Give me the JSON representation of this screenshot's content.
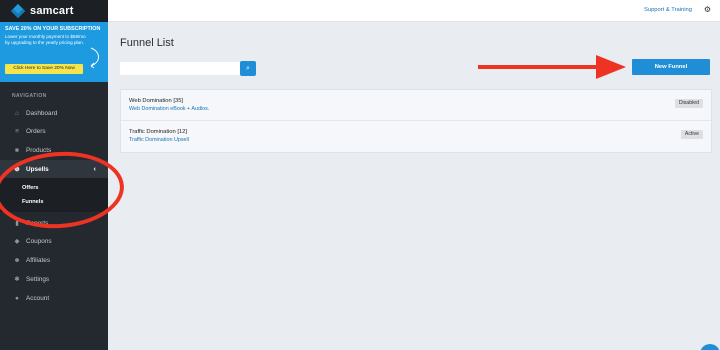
{
  "brand": {
    "name": "samcart",
    "accent": "#1f8ed6"
  },
  "promo": {
    "title": "SAVE 20% ON YOUR SUBSCRIPTION",
    "body": "Lower your monthly payment to $59/mo by upgrading to the yearly pricing plan.",
    "button": "Click Here to Save 20% Now"
  },
  "sidebar": {
    "heading": "NAVIGATION",
    "items": [
      {
        "label": "Dashboard",
        "icon": "home-icon",
        "glyph": "⌂"
      },
      {
        "label": "Orders",
        "icon": "cart-icon",
        "glyph": "≡"
      },
      {
        "label": "Products",
        "icon": "tag-icon",
        "glyph": "■"
      },
      {
        "label": "Upsells",
        "icon": "plus-circle-icon",
        "glyph": "⊕"
      },
      {
        "label": "Reports",
        "icon": "chart-icon",
        "glyph": "▮"
      },
      {
        "label": "Coupons",
        "icon": "tag-icon",
        "glyph": "◆"
      },
      {
        "label": "Affiliates",
        "icon": "users-icon",
        "glyph": "☻"
      },
      {
        "label": "Settings",
        "icon": "gear-icon",
        "glyph": "✱"
      },
      {
        "label": "Account",
        "icon": "user-icon",
        "glyph": "●"
      }
    ],
    "sub_items": [
      {
        "label": "Offers"
      },
      {
        "label": "Funnels"
      }
    ],
    "chevron": "‹"
  },
  "topbar": {
    "support": "Support & Training",
    "gear_glyph": "⚙"
  },
  "main": {
    "title": "Funnel List",
    "search": {
      "value": "",
      "placeholder": "",
      "glyph": "⌕"
    },
    "new_button": "New Funnel",
    "funnels": [
      {
        "name": "Web Domination [35]",
        "product": "Web Domination eBook + Audios.",
        "status": "Disabled"
      },
      {
        "name": "Traffic Domination [12]",
        "product": "Traffic Domination Upsell",
        "status": "Active"
      }
    ]
  }
}
